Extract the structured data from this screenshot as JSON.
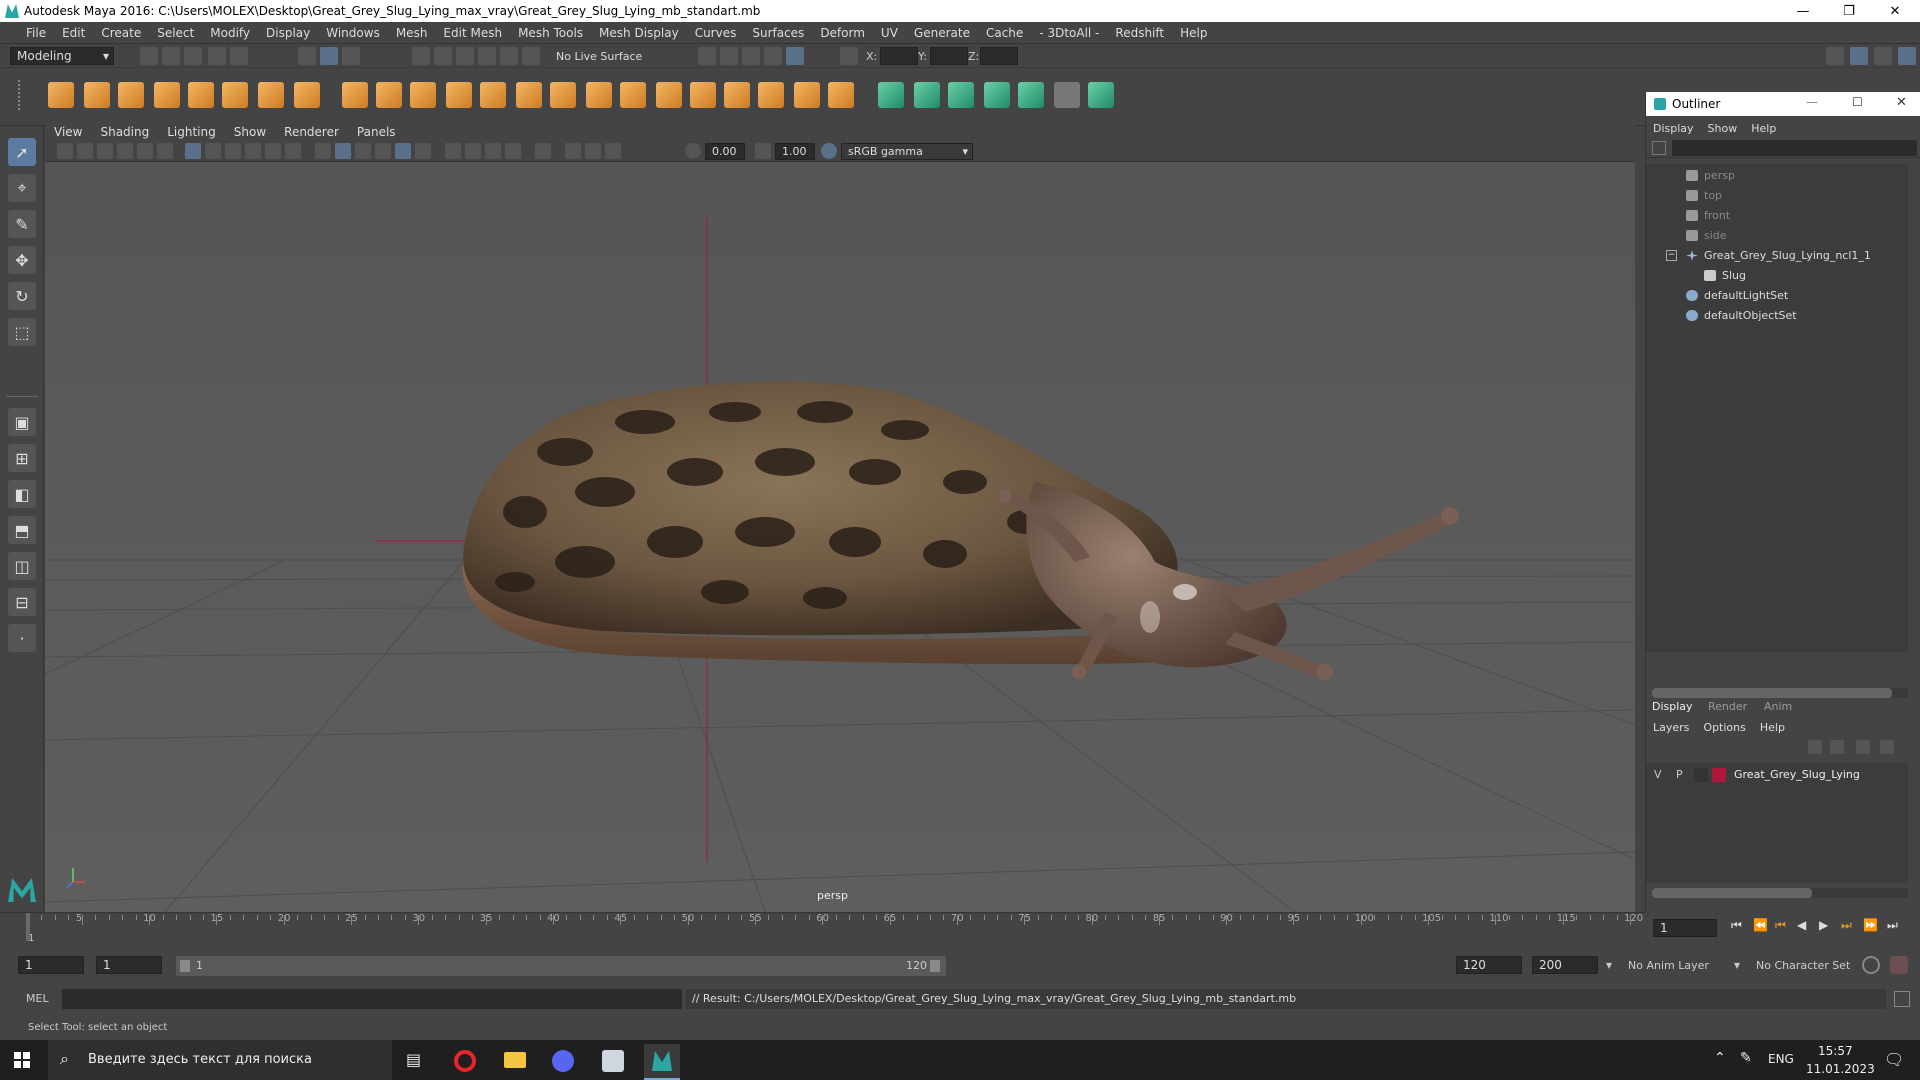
{
  "window": {
    "title": "Autodesk Maya 2016: C:\\Users\\MOLEX\\Desktop\\Great_Grey_Slug_Lying_max_vray\\Great_Grey_Slug_Lying_mb_standart.mb"
  },
  "menu": [
    "File",
    "Edit",
    "Create",
    "Select",
    "Modify",
    "Display",
    "Windows",
    "Mesh",
    "Edit Mesh",
    "Mesh Tools",
    "Mesh Display",
    "Curves",
    "Surfaces",
    "Deform",
    "UV",
    "Generate",
    "Cache",
    "- 3DtoAll -",
    "Redshift",
    "Help"
  ],
  "statusline": {
    "mode": "Modeling",
    "live_surface": "No Live Surface",
    "x_label": "X:",
    "y_label": "Y:",
    "z_label": "Z:"
  },
  "viewport": {
    "menu": [
      "View",
      "Shading",
      "Lighting",
      "Show",
      "Renderer",
      "Panels"
    ],
    "exposure": "0.00",
    "gamma": "1.00",
    "color_space": "sRGB gamma",
    "camera_label": "persp"
  },
  "outliner": {
    "title": "Outliner",
    "menu": [
      "Display",
      "Show",
      "Help"
    ],
    "items": [
      {
        "label": "persp",
        "type": "camera",
        "dim": true,
        "indent": 0
      },
      {
        "label": "top",
        "type": "camera",
        "dim": true,
        "indent": 0
      },
      {
        "label": "front",
        "type": "camera",
        "dim": true,
        "indent": 0
      },
      {
        "label": "side",
        "type": "camera",
        "dim": true,
        "indent": 0
      },
      {
        "label": "Great_Grey_Slug_Lying_ncl1_1",
        "type": "group",
        "dim": false,
        "indent": 0
      },
      {
        "label": "Slug",
        "type": "mesh",
        "dim": false,
        "indent": 1
      },
      {
        "label": "defaultLightSet",
        "type": "set",
        "dim": false,
        "indent": 0
      },
      {
        "label": "defaultObjectSet",
        "type": "set",
        "dim": false,
        "indent": 0
      }
    ]
  },
  "layers": {
    "tabs": [
      "Display",
      "Render",
      "Anim"
    ],
    "menu": [
      "Layers",
      "Options",
      "Help"
    ],
    "rows": [
      {
        "v": "V",
        "p": "P",
        "color": "#b0153a",
        "name": "Great_Grey_Slug_Lying"
      }
    ]
  },
  "timeline": {
    "ticks": [
      "5",
      "10",
      "15",
      "20",
      "25",
      "30",
      "35",
      "40",
      "45",
      "50",
      "55",
      "60",
      "65",
      "70",
      "75",
      "80",
      "85",
      "90",
      "95",
      "100",
      "105",
      "110",
      "115",
      "120"
    ],
    "start_label": "1",
    "current_frame": "1"
  },
  "range": {
    "start": "1",
    "current": "1",
    "slider_start": "1",
    "slider_end": "120",
    "end": "120",
    "max_end": "200",
    "anim_layer": "No Anim Layer",
    "character_set": "No Character Set"
  },
  "cmd": {
    "type": "MEL",
    "result": "// Result: C:/Users/MOLEX/Desktop/Great_Grey_Slug_Lying_max_vray/Great_Grey_Slug_Lying_mb_standart.mb"
  },
  "help": "Select Tool: select an object",
  "taskbar": {
    "search_placeholder": "Введите здесь текст для поиска",
    "lang": "ENG",
    "time": "15:57",
    "date": "11.01.2023"
  },
  "colors": {
    "accent": "#5d7ba0",
    "shelf_orange": "#e0952e",
    "shelf_green": "#3dbb8c"
  }
}
